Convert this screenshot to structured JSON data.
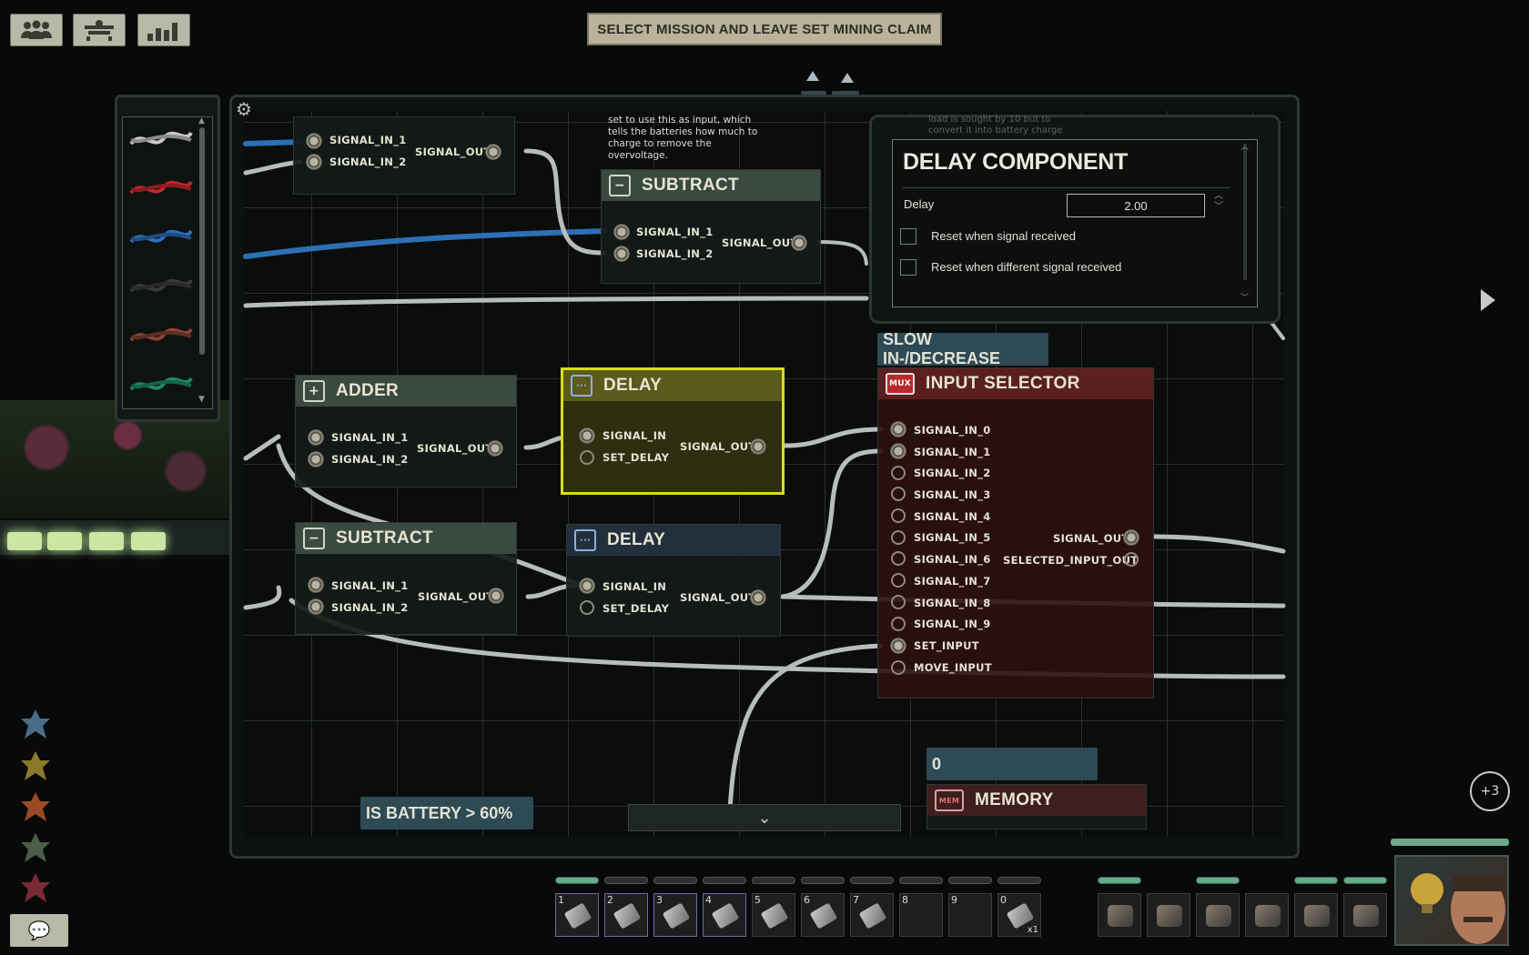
{
  "objective": "SELECT MISSION AND LEAVE SET MINING CLAIM",
  "top_buttons": [
    "crew-icon",
    "tab-icon",
    "stats-icon"
  ],
  "tooltip_text": [
    "set to use this as input, which",
    "tells the batteries how much to",
    "charge to remove the",
    "overvoltage."
  ],
  "components": {
    "top_left": {
      "pins_in": [
        "SIGNAL_IN_1",
        "SIGNAL_IN_2"
      ],
      "pin_out": "SIGNAL_OUT"
    },
    "subtract_top": {
      "title": "SUBTRACT",
      "pins_in": [
        "SIGNAL_IN_1",
        "SIGNAL_IN_2"
      ],
      "pin_out": "SIGNAL_OUT"
    },
    "adder": {
      "title": "ADDER",
      "pins_in": [
        "SIGNAL_IN_1",
        "SIGNAL_IN_2"
      ],
      "pin_out": "SIGNAL_OUT"
    },
    "delay_selected": {
      "title": "DELAY",
      "pins_in": [
        "SIGNAL_IN",
        "SET_DELAY"
      ],
      "pin_out": "SIGNAL_OUT"
    },
    "subtract_bottom": {
      "title": "SUBTRACT",
      "pins_in": [
        "SIGNAL_IN_1",
        "SIGNAL_IN_2"
      ],
      "pin_out": "SIGNAL_OUT"
    },
    "delay_bottom": {
      "title": "DELAY",
      "pins_in": [
        "SIGNAL_IN",
        "SET_DELAY"
      ],
      "pin_out": "SIGNAL_OUT"
    },
    "input_selector": {
      "title": "INPUT SELECTOR",
      "badge": "MUX",
      "pins_in": [
        "SIGNAL_IN_0",
        "SIGNAL_IN_1",
        "SIGNAL_IN_2",
        "SIGNAL_IN_3",
        "SIGNAL_IN_4",
        "SIGNAL_IN_5",
        "SIGNAL_IN_6",
        "SIGNAL_IN_7",
        "SIGNAL_IN_8",
        "SIGNAL_IN_9",
        "SET_INPUT",
        "MOVE_INPUT"
      ],
      "pins_out": [
        "SIGNAL_OUT",
        "SELECTED_INPUT_OUT"
      ]
    },
    "memory": {
      "title": "MEMORY",
      "badge": "MEM"
    }
  },
  "labels": {
    "slow": "SLOW IN-/DECREASE",
    "zero": "0",
    "battery": "IS BATTERY > 60%"
  },
  "properties": {
    "faded_text": [
      "load is sought by 10 but to",
      "convert it into battery charge"
    ],
    "title": "DELAY COMPONENT",
    "delay_label": "Delay",
    "delay_value": "2.00",
    "option1": "Reset when signal received",
    "option2": "Reset when different signal received"
  },
  "hotbar": {
    "slots": [
      {
        "num": "1",
        "icon": "screwdriver-icon"
      },
      {
        "num": "2",
        "icon": "wrench-icon"
      },
      {
        "num": "3",
        "icon": "rifle-icon"
      },
      {
        "num": "4",
        "icon": "screwdriver-icon"
      },
      {
        "num": "5",
        "icon": "diving-mask-icon"
      },
      {
        "num": "6",
        "icon": "flashlight-icon"
      },
      {
        "num": "7",
        "icon": "welder-icon"
      },
      {
        "num": "8",
        "icon": ""
      },
      {
        "num": "9",
        "icon": ""
      },
      {
        "num": "0",
        "icon": "syringe-icon",
        "count": "x1"
      }
    ],
    "equipment": [
      "gun-icon",
      "helmet-icon",
      "vest-icon",
      "headset-icon",
      "goggles-icon",
      "id-card-icon"
    ]
  },
  "notification_count": "+3",
  "talent_icons": [
    "talent-1-icon",
    "talent-2-icon",
    "talent-3-icon",
    "talent-4-icon",
    "talent-5-icon"
  ]
}
